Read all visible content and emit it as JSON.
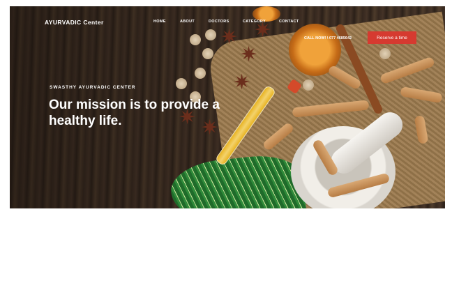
{
  "brand": {
    "name": "AYURVADIC  Center"
  },
  "nav": {
    "items": [
      {
        "label": "HOME"
      },
      {
        "label": "ABOUT"
      },
      {
        "label": "DOCTORS"
      },
      {
        "label": "CATEGORY"
      },
      {
        "label": "CONTACT"
      }
    ]
  },
  "header": {
    "call_text": "CALL NOW! \\ 077 4685642",
    "reserve_label": "Reserve a time"
  },
  "hero": {
    "tagline": "SWASTHY AYURVADIC CENTER",
    "headline": "Our mission is to provide a healthy life."
  },
  "colors": {
    "accent": "#d63a30",
    "text_on_hero": "#ffffff"
  }
}
